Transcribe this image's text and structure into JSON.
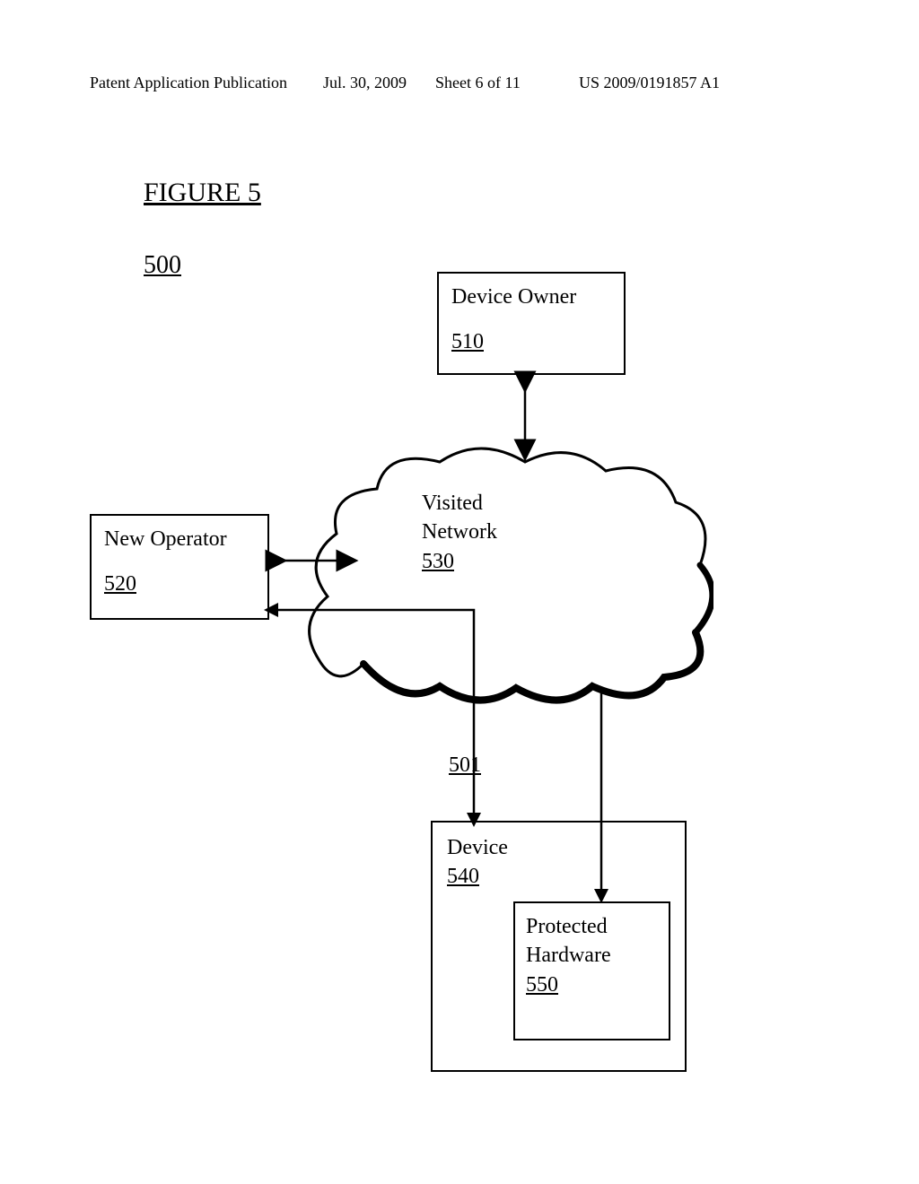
{
  "header": {
    "publication_type": "Patent Application Publication",
    "date": "Jul. 30, 2009",
    "sheet": "Sheet 6 of 11",
    "pub_number": "US 2009/0191857 A1"
  },
  "figure": {
    "title": "FIGURE 5",
    "number": "500"
  },
  "boxes": {
    "device_owner": {
      "label": "Device Owner",
      "ref": "510"
    },
    "new_operator": {
      "label": "New Operator",
      "ref": "520"
    },
    "visited_network": {
      "label": "Visited",
      "label2": "Network",
      "ref": "530"
    },
    "device": {
      "label": "Device",
      "ref": "540"
    },
    "protected_hw": {
      "label": "Protected",
      "label2": "Hardware",
      "ref": "550"
    }
  },
  "refs": {
    "arrow_501": "501"
  }
}
